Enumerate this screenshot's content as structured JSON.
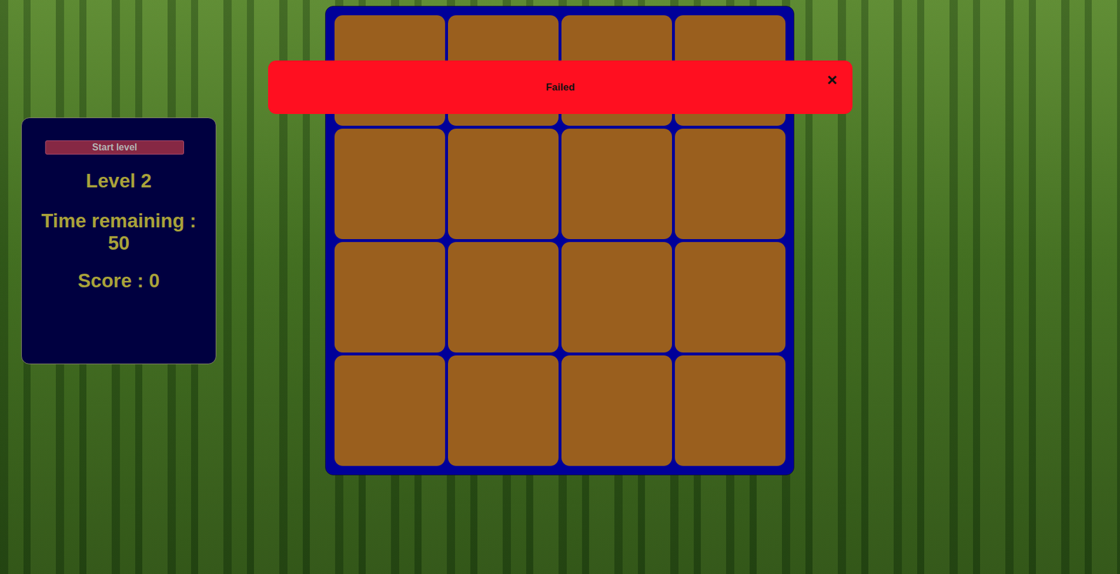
{
  "panel": {
    "start_button": {
      "label": "Start level",
      "disabled": true
    },
    "level": "Level 2",
    "time_label": "Time remaining :",
    "time": "50",
    "score": "Score : 0"
  },
  "board": {
    "tiles": [
      {
        "revealed": false
      },
      {
        "revealed": false
      },
      {
        "revealed": false
      },
      {
        "revealed": false
      },
      {
        "revealed": false
      },
      {
        "revealed": false
      },
      {
        "revealed": false
      },
      {
        "revealed": false
      },
      {
        "revealed": false
      },
      {
        "revealed": false
      },
      {
        "revealed": false
      },
      {
        "revealed": false
      },
      {
        "revealed": false
      },
      {
        "revealed": false
      },
      {
        "revealed": false
      },
      {
        "revealed": false
      }
    ]
  },
  "banner": {
    "message": "Failed",
    "close": "×"
  }
}
